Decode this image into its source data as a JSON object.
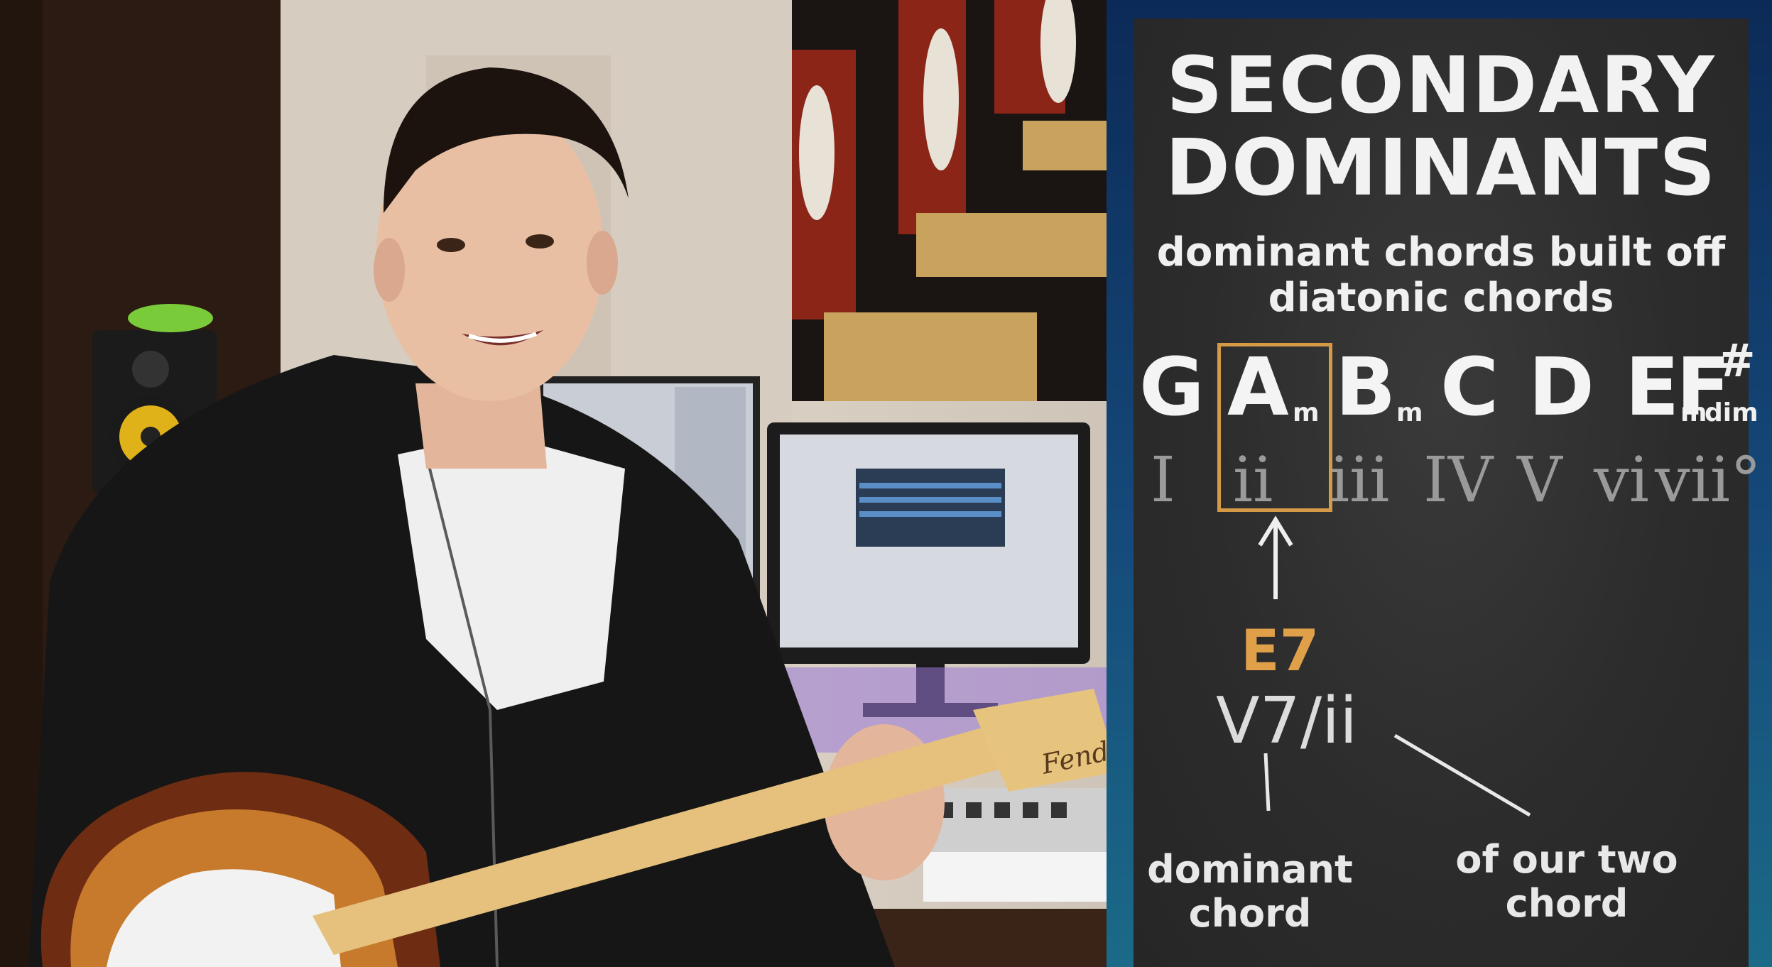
{
  "board": {
    "title_line1": "SECONDARY",
    "title_line2": "DOMINANTS",
    "subtitle_line1": "dominant chords built off",
    "subtitle_line2": "diatonic chords",
    "chords": [
      {
        "root": "G",
        "quality": ""
      },
      {
        "root": "A",
        "quality": "m"
      },
      {
        "root": "B",
        "quality": "m"
      },
      {
        "root": "C",
        "quality": ""
      },
      {
        "root": "D",
        "quality": ""
      },
      {
        "root": "E",
        "quality": "m"
      },
      {
        "root": "F",
        "accidental": "#",
        "quality": "dim"
      }
    ],
    "numerals": [
      "I",
      "ii",
      "iii",
      "IV",
      "V",
      "vi",
      "vii°"
    ],
    "secondary_chord": "E7",
    "secondary_numeral": "V7/ii",
    "note_left_line1": "dominant",
    "note_left_line2": "chord",
    "note_right_line1": "of our two",
    "note_right_line2": "chord",
    "accent_color": "#d49a45"
  },
  "photo": {
    "guitar_brand": "Fender"
  }
}
